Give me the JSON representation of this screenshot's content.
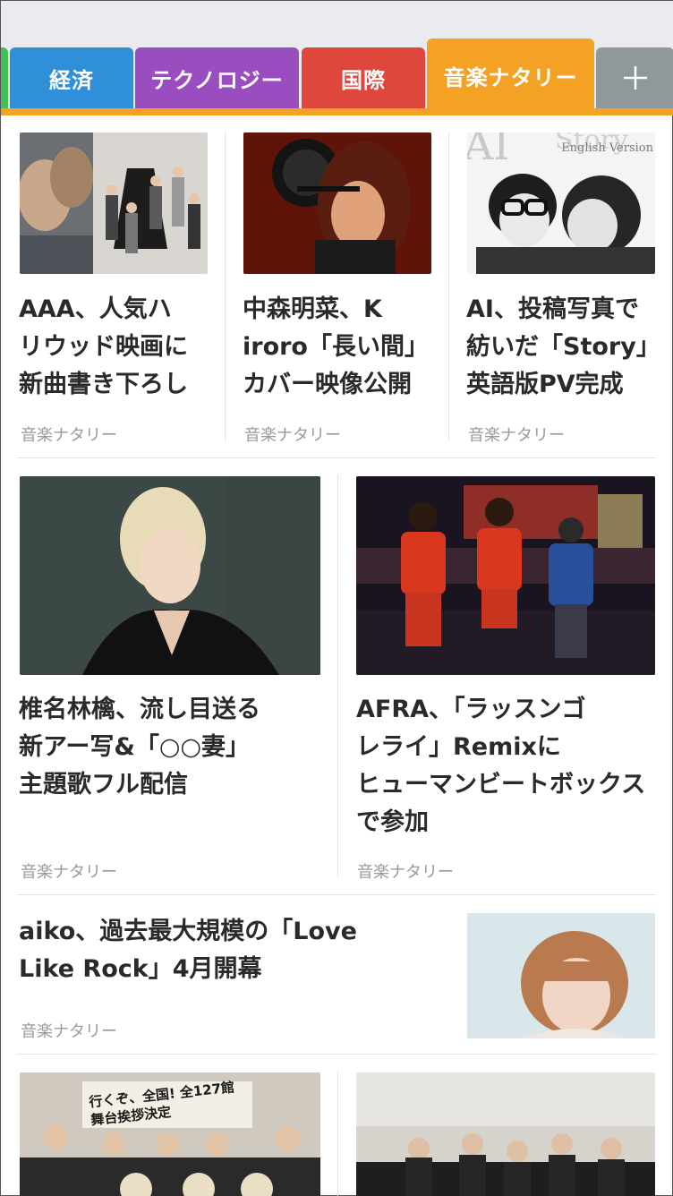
{
  "tabs": [
    {
      "label": "経済"
    },
    {
      "label": "テクノロジー"
    },
    {
      "label": "国際"
    },
    {
      "label": "音楽ナタリー"
    },
    {
      "label": "+"
    }
  ],
  "colors": {
    "tab_keizai": "#2f8fd8",
    "tab_technology": "#9a4dbf",
    "tab_kokusai": "#e0473c",
    "tab_music_active": "#f4a224",
    "tab_add": "#8f999b"
  },
  "articles": [
    {
      "title": "AAA、人気ハリウッド映画に新曲書き下ろし",
      "title_lines": [
        "AAA、人気ハ",
        "リウッド映画に",
        "新曲書き下ろし"
      ],
      "source": "音楽ナタリー"
    },
    {
      "title": "中森明菜、Kiroro「長い間」カバー映像公開",
      "title_lines": [
        "中森明菜、K",
        "iroro「長い間」",
        "カバー映像公開"
      ],
      "source": "音楽ナタリー"
    },
    {
      "title": "AI、投稿写真で紡いだ「Story」英語版PV完成",
      "title_lines": [
        "AI、投稿写真で",
        "紡いだ「Story」",
        "英語版PV完成"
      ],
      "source": "音楽ナタリー",
      "image_caption": "English Version"
    },
    {
      "title": "椎名林檎、流し目送る新アー写&「○○妻」主題歌フル配信",
      "title_lines": [
        "椎名林檎、流し目送る",
        "新アー写&「○○妻」",
        "主題歌フル配信"
      ],
      "source": "音楽ナタリー"
    },
    {
      "title": "AFRA、「ラッスンゴレライ」Remixにヒューマンビートボックスで参加",
      "title_lines": [
        "AFRA、「ラッスンゴ",
        "レライ」Remixに",
        "ヒューマンビートボックス",
        "で参加"
      ],
      "source": "音楽ナタリー"
    },
    {
      "title": "aiko、過去最大規模の「Love Like Rock」4月開幕",
      "title_lines": [
        "aiko、過去最大規模の「Love",
        "Like Rock」4月開幕"
      ],
      "source": "音楽ナタリー"
    },
    {
      "title": "",
      "title_lines": [],
      "source": "",
      "image_caption": "行くぞ、全国! 全127館 舞台挨拶決定"
    },
    {
      "title": "",
      "title_lines": [],
      "source": ""
    }
  ]
}
